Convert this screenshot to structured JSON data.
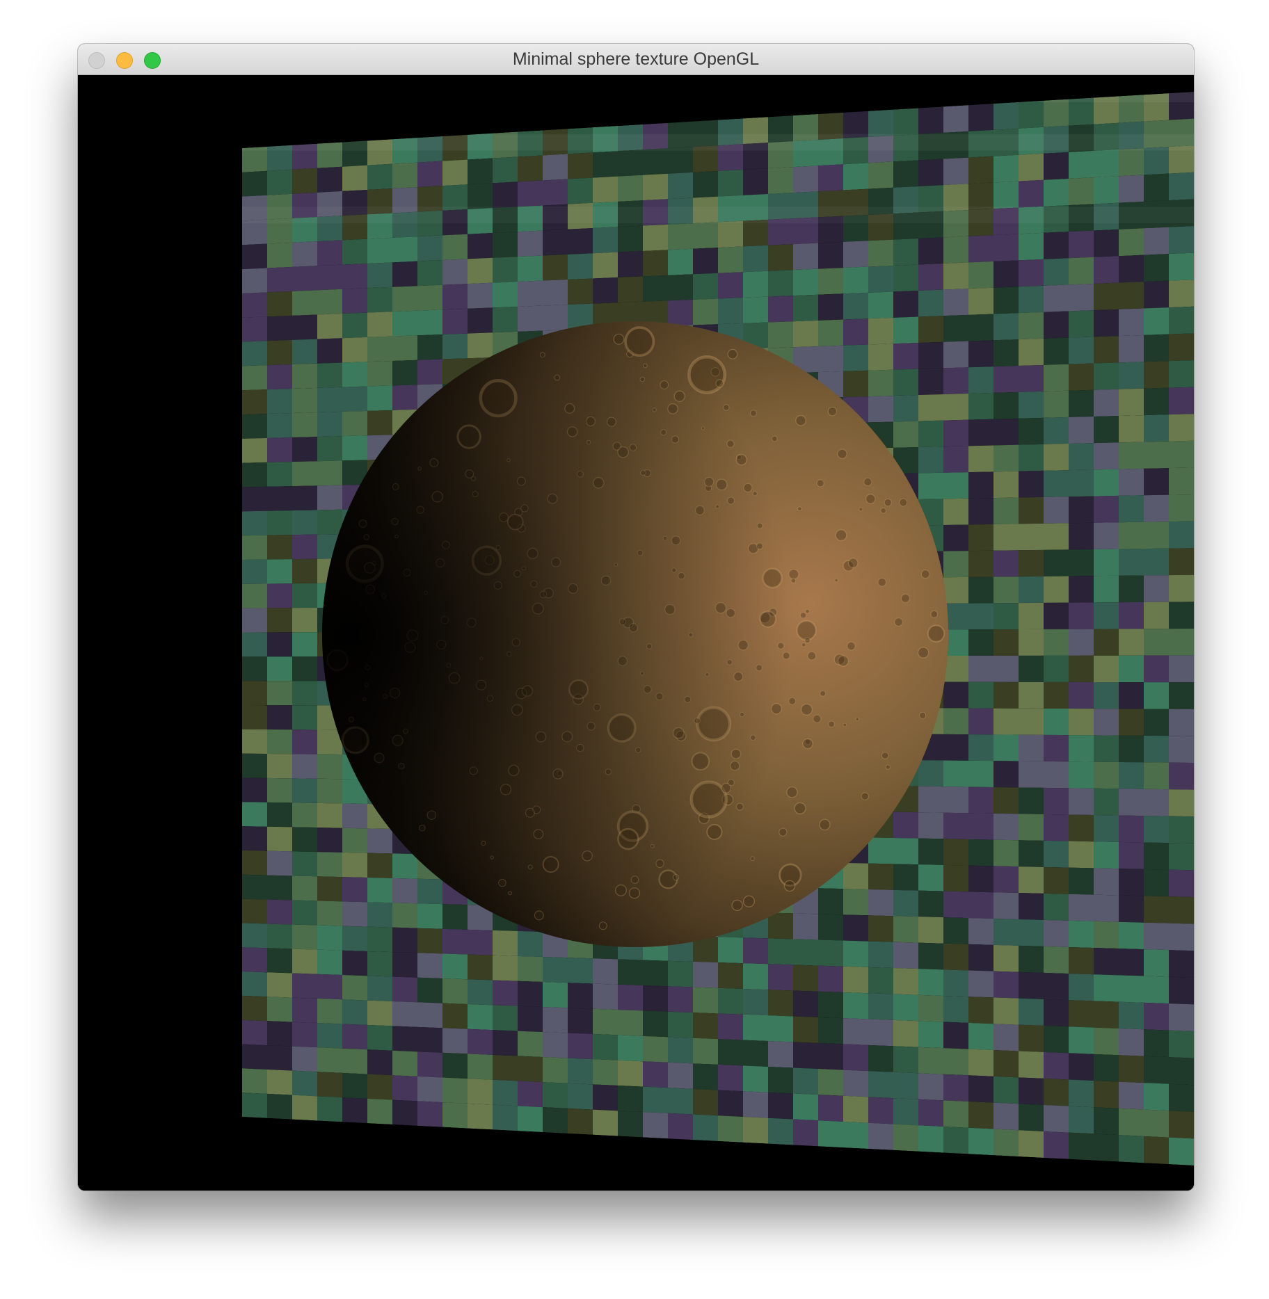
{
  "window": {
    "title": "Minimal sphere texture OpenGL",
    "controls": {
      "close_icon": "close-icon",
      "minimize_icon": "minimize-icon",
      "zoom_icon": "zoom-icon"
    }
  },
  "scene": {
    "background_color": "#000000",
    "plane": {
      "description_icon": "checkerboard-plane",
      "palette": [
        "#2a2338",
        "#1f3a2a",
        "#3a3f24",
        "#3c7a5e",
        "#4d6e4a",
        "#5a5a6e",
        "#2f5a44",
        "#46365a",
        "#6a7a4c",
        "#355e52"
      ]
    },
    "sphere": {
      "description_icon": "cratered-moon-sphere",
      "base_color": "#8a6a3e",
      "highlight_color": "#b07e52",
      "shadow_color": "#000000"
    }
  }
}
